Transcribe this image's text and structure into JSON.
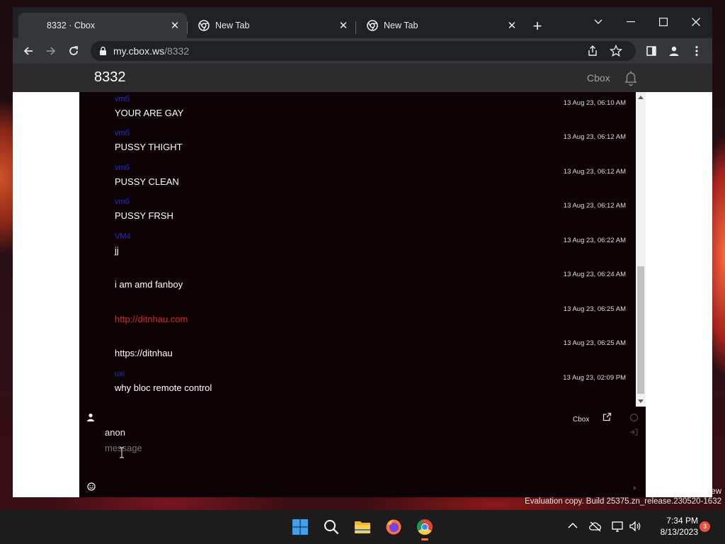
{
  "browser": {
    "tabs": [
      {
        "label": "8332 · Cbox",
        "active": true
      },
      {
        "label": "New Tab",
        "active": false
      },
      {
        "label": "New Tab",
        "active": false
      }
    ],
    "url_host": "my.cbox.ws",
    "url_path": "/8332"
  },
  "cbox": {
    "room_title": "8332",
    "brand": "Cbox",
    "messages": [
      {
        "author": "vmб",
        "text": "YOUR ARE GAY",
        "time": "13 Aug 23, 06:10 AM",
        "link": false
      },
      {
        "author": "vmб",
        "text": "PUSSY THIGHT",
        "time": "13 Aug 23, 06:12 AM",
        "link": false
      },
      {
        "author": "vmб",
        "text": "PUSSY CLEAN",
        "time": "13 Aug 23, 06:12 AM",
        "link": false
      },
      {
        "author": "vmб",
        "text": "PUSSY FRSH",
        "time": "13 Aug 23, 06:12 AM",
        "link": false
      },
      {
        "author": "VM4",
        "text": "jj",
        "time": "13 Aug 23, 06:22 AM",
        "link": false
      },
      {
        "author": "",
        "text": "i am amd fanboy",
        "time": "13 Aug 23, 06:24 AM",
        "link": false
      },
      {
        "author": "",
        "text": "http://ditnhau.com",
        "time": "13 Aug 23, 06:25 AM",
        "link": true
      },
      {
        "author": "",
        "text": "https://ditnhau",
        "time": "13 Aug 23, 06:25 AM",
        "link": false
      },
      {
        "author": "uxi",
        "text": "why bloc remote control",
        "time": "13 Aug 23, 02:09 PM",
        "link": false
      }
    ],
    "composer": {
      "cbox_link": "Cbox",
      "name_value": "anon",
      "message_placeholder": "message"
    }
  },
  "desktop": {
    "watermark_line1": "ew",
    "watermark_line2": "Evaluation copy. Build 25375.zn_release.230520-1632",
    "clock_time": "7:34 PM",
    "clock_date": "8/13/2023",
    "notification_count": "3"
  },
  "colors": {
    "chat_bg": "#0d0204",
    "author": "#2b2bd4",
    "link": "#d42828",
    "header_bg": "#2c2c2c"
  }
}
